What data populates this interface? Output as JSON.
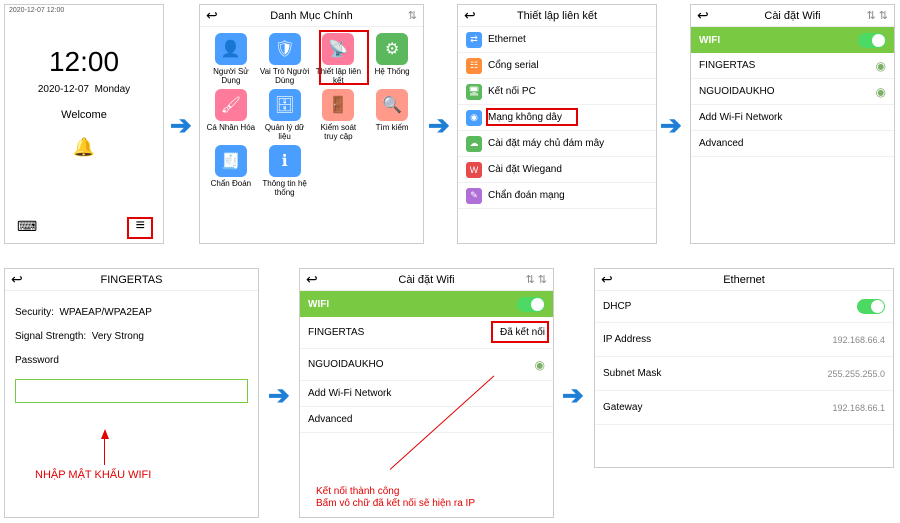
{
  "p1": {
    "status": "2020-12-07 12:00",
    "time": "12:00",
    "date": "2020-12-07",
    "day": "Monday",
    "welcome": "Welcome"
  },
  "p2": {
    "title": "Danh Mục Chính",
    "cells": [
      {
        "label": "Người Sử Dụng",
        "color": "blue",
        "glyph": "👤"
      },
      {
        "label": "Vai Trò Người Dùng",
        "color": "blue",
        "glyph": "🛡"
      },
      {
        "label": "Thiết lập liên kết",
        "color": "pink",
        "glyph": "📡"
      },
      {
        "label": "Hệ Thống",
        "color": "green",
        "glyph": "⚙"
      },
      {
        "label": "Cá Nhân Hóa",
        "color": "pink",
        "glyph": "🖌"
      },
      {
        "label": "Quản lý dữ liệu",
        "color": "blue",
        "glyph": "🗄"
      },
      {
        "label": "Kiểm soát truy cập",
        "color": "salmon",
        "glyph": "🚪"
      },
      {
        "label": "Tìm kiếm",
        "color": "salmon",
        "glyph": "🔍"
      },
      {
        "label": "Chẩn Đoán",
        "color": "blue",
        "glyph": "🧾"
      },
      {
        "label": "Thông tin hệ thống",
        "color": "blue",
        "glyph": "ℹ"
      }
    ]
  },
  "p3": {
    "title": "Thiết lập liên kết",
    "items": [
      {
        "label": "Ethernet",
        "color": "#4a9eff",
        "glyph": "⇄"
      },
      {
        "label": "Cổng serial",
        "color": "#ff8c3b",
        "glyph": "☷"
      },
      {
        "label": "Kết nối PC",
        "color": "#5cb85c",
        "glyph": "🖥"
      },
      {
        "label": "Mạng không dây",
        "color": "#4a9eff",
        "glyph": "◉"
      },
      {
        "label": "Cài đặt máy chủ đám mây",
        "color": "#5cb85c",
        "glyph": "☁"
      },
      {
        "label": "Cài đặt Wiegand",
        "color": "#e64a4a",
        "glyph": "W"
      },
      {
        "label": "Chẩn đoán mạng",
        "color": "#b06fd6",
        "glyph": "✎"
      }
    ]
  },
  "p4": {
    "title": "Cài đặt Wifi",
    "wifi": "WIFI",
    "nets": [
      {
        "name": "FINGERTAS"
      },
      {
        "name": "NGUOIDAUKHO"
      }
    ],
    "add": "Add Wi-Fi Network",
    "adv": "Advanced"
  },
  "p5": {
    "title": "FINGERTAS",
    "sec_l": "Security:",
    "sec_v": "WPAEAP/WPA2EAP",
    "sig_l": "Signal Strength:",
    "sig_v": "Very Strong",
    "pwd": "Password",
    "note": "NHẬP MẬT KHẨU WIFI"
  },
  "p6": {
    "title": "Cài đặt Wifi",
    "wifi": "WIFI",
    "nets": [
      {
        "name": "FINGERTAS",
        "status": "Đã kết nối"
      },
      {
        "name": "NGUOIDAUKHO"
      }
    ],
    "add": "Add Wi-Fi Network",
    "adv": "Advanced",
    "note1": "Kết nối thành công",
    "note2": "Bấm vô chữ đã kết nối sẽ hiện ra IP"
  },
  "p7": {
    "title": "Ethernet",
    "dhcp": "DHCP",
    "rows": [
      {
        "label": "IP Address",
        "val": "192.168.66.4"
      },
      {
        "label": "Subnet Mask",
        "val": "255.255.255.0"
      },
      {
        "label": "Gateway",
        "val": "192.168.66.1"
      }
    ]
  }
}
